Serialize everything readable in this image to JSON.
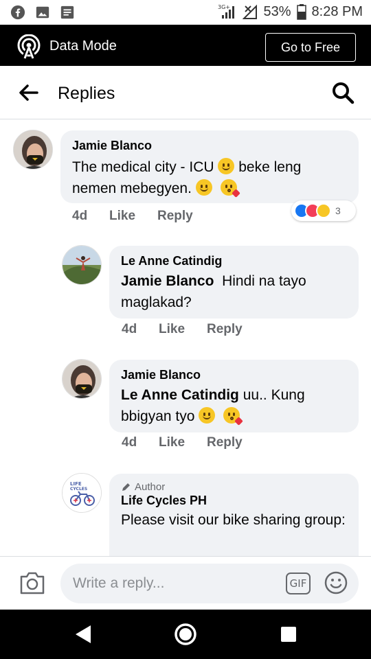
{
  "status_bar": {
    "network": "3G+",
    "battery": "53%",
    "time": "8:28 PM"
  },
  "data_mode": {
    "label": "Data Mode",
    "button": "Go to Free"
  },
  "header": {
    "title": "Replies"
  },
  "comments": [
    {
      "name": "Jamie Blanco",
      "text_line1": "The medical city - ICU",
      "text_mid": "beke leng",
      "text_line2": "nemen mebegyen.",
      "time": "4d",
      "like": "Like",
      "reply": "Reply",
      "reactions_count": "3"
    },
    {
      "name": "Le Anne Catindig",
      "mention": "Jamie Blanco",
      "text": "Hindi na tayo maglakad?",
      "time": "4d",
      "like": "Like",
      "reply": "Reply"
    },
    {
      "name": "Jamie Blanco",
      "mention": "Le Anne Catindig",
      "text_a": "uu.. Kung",
      "text_b": "bbigyan tyo",
      "time": "4d",
      "like": "Like",
      "reply": "Reply"
    },
    {
      "badge": "Author",
      "name": "Life Cycles PH",
      "text": "Please visit our bike sharing group:",
      "avatar_logo": "LIFE CYCLES"
    }
  ],
  "compose": {
    "placeholder": "Write a reply...",
    "gif": "GIF"
  },
  "colors": {
    "accent": "#1877f2",
    "bubble": "#f0f2f5",
    "meta": "#65676b"
  }
}
